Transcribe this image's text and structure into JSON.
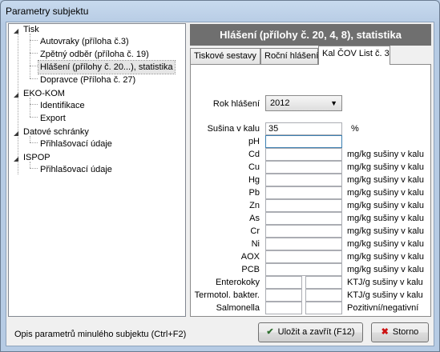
{
  "window": {
    "title": "Parametry subjektu"
  },
  "tree": {
    "tisk": "Tisk",
    "autovraky": "Autovraky (příloha č.3)",
    "zpetny": "Zpětný odběr (příloha č. 19)",
    "hlaseni": "Hlášení  (přílohy č. 20...), statistika",
    "dopravce": "Dopravce (Příloha č. 27)",
    "ekokom": "EKO-KOM",
    "identifikace": "Identifikace",
    "export": "Export",
    "datove": "Datové schránky",
    "prihl1": "Přihlašovací údaje",
    "ispop": "ISPOP",
    "prihl2": "Přihlašovací údaje"
  },
  "header": {
    "title": "Hlášení  (přílohy č. 20, 4, 8), statistika"
  },
  "tabs": {
    "tiskove": "Tiskové sestavy",
    "rocni": "Roční hlášení",
    "kalcov": "Kal ČOV List č. 3"
  },
  "form": {
    "rok_label": "Rok hlášení",
    "rok_value": "2012",
    "susina_label": "Sušina v kalu",
    "susina_value": "35",
    "susina_unit": "%",
    "ph_label": "pH",
    "cd_label": "Cd",
    "cu_label": "Cu",
    "hg_label": "Hg",
    "pb_label": "Pb",
    "zn_label": "Zn",
    "as_label": "As",
    "cr_label": "Cr",
    "ni_label": "Ni",
    "aox_label": "AOX",
    "pcb_label": "PCB",
    "metal_unit": "mg/kg sušiny v kalu",
    "entero_label": "Enterokoky",
    "termo_label": "Termotol. bakter.",
    "salmo_label": "Salmonella",
    "ktj_unit": "KTJ/g sušiny v kalu",
    "salmo_unit": "Pozitivní/negativní"
  },
  "footer": {
    "hint": "Opis parametrů minulého subjektu (Ctrl+F2)",
    "save_label": "Uložit a zavřít (F12)",
    "cancel_label": "Storno"
  },
  "colors": {
    "save_check": "#2f6f2f",
    "cancel_x": "#cc1111",
    "header_bg": "#6f6f6f"
  }
}
